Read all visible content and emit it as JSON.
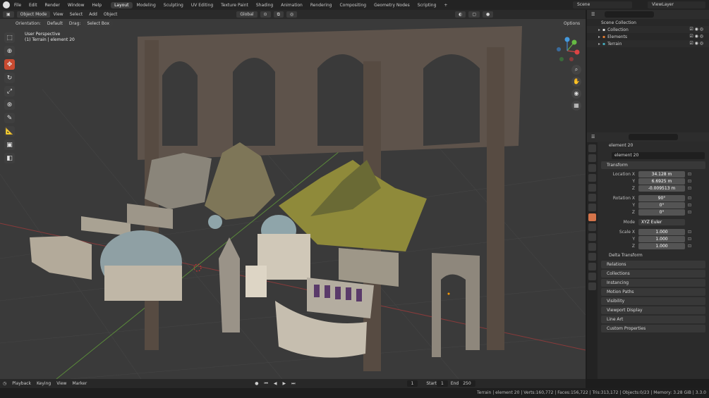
{
  "menus": [
    "File",
    "Edit",
    "Render",
    "Window",
    "Help"
  ],
  "workspaces": [
    "Layout",
    "Modeling",
    "Sculpting",
    "UV Editing",
    "Texture Paint",
    "Shading",
    "Animation",
    "Rendering",
    "Compositing",
    "Geometry Nodes",
    "Scripting"
  ],
  "active_workspace": "Layout",
  "scene_name": "Scene",
  "view_layer": "ViewLayer",
  "viewport": {
    "mode": "Object Mode",
    "menus": [
      "View",
      "Select",
      "Add",
      "Object"
    ],
    "transform_orientation": "Global",
    "orientation_label": "Orientation:",
    "orientation_value": "Default",
    "drag_label": "Drag:",
    "drag_value": "Select Box",
    "options_label": "Options",
    "info_line1": "User Perspective",
    "info_line2": "(1) Terrain | element 20",
    "tools": [
      "select-box-icon",
      "cursor-icon",
      "move-icon",
      "rotate-icon",
      "scale-icon",
      "transform-icon",
      "annotate-icon",
      "measure-icon",
      "add-cube-icon",
      "extrude-icon"
    ],
    "nav_icons": [
      "zoom-icon",
      "pan-hand-icon",
      "camera-icon",
      "grid-view-icon"
    ]
  },
  "outliner": {
    "root": "Scene Collection",
    "items": [
      {
        "label": "Collection"
      },
      {
        "label": "Elements"
      },
      {
        "label": "Terrain"
      }
    ]
  },
  "properties": {
    "object_name": "element 20",
    "data_name": "element 20",
    "transform_title": "Transform",
    "location": {
      "label": "Location X",
      "x": "34.128 m",
      "y": "6.6925 m",
      "z": "-0.009513 m"
    },
    "rotation": {
      "label": "Rotation X",
      "x": "90°",
      "y": "0°",
      "z": "0°"
    },
    "mode_label": "Mode",
    "mode_value": "XYZ Euler",
    "scale": {
      "label": "Scale X",
      "x": "1.000",
      "y": "1.000",
      "z": "1.000"
    },
    "axis_y": "Y",
    "axis_z": "Z",
    "delta_transform": "Delta Transform",
    "panels": [
      "Relations",
      "Collections",
      "Instancing",
      "Motion Paths",
      "Visibility",
      "Viewport Display",
      "Line Art",
      "Custom Properties"
    ]
  },
  "timeline": {
    "menus": [
      "Playback",
      "Keying",
      "View",
      "Marker"
    ],
    "current_frame": "1",
    "start_label": "Start",
    "start": "1",
    "end_label": "End",
    "end": "250"
  },
  "status": "Terrain | element 20 | Verts:160,772 | Faces:156,722 | Tris:313,172 | Objects:0/23 | Memory: 3.28 GiB | 3.3.0"
}
